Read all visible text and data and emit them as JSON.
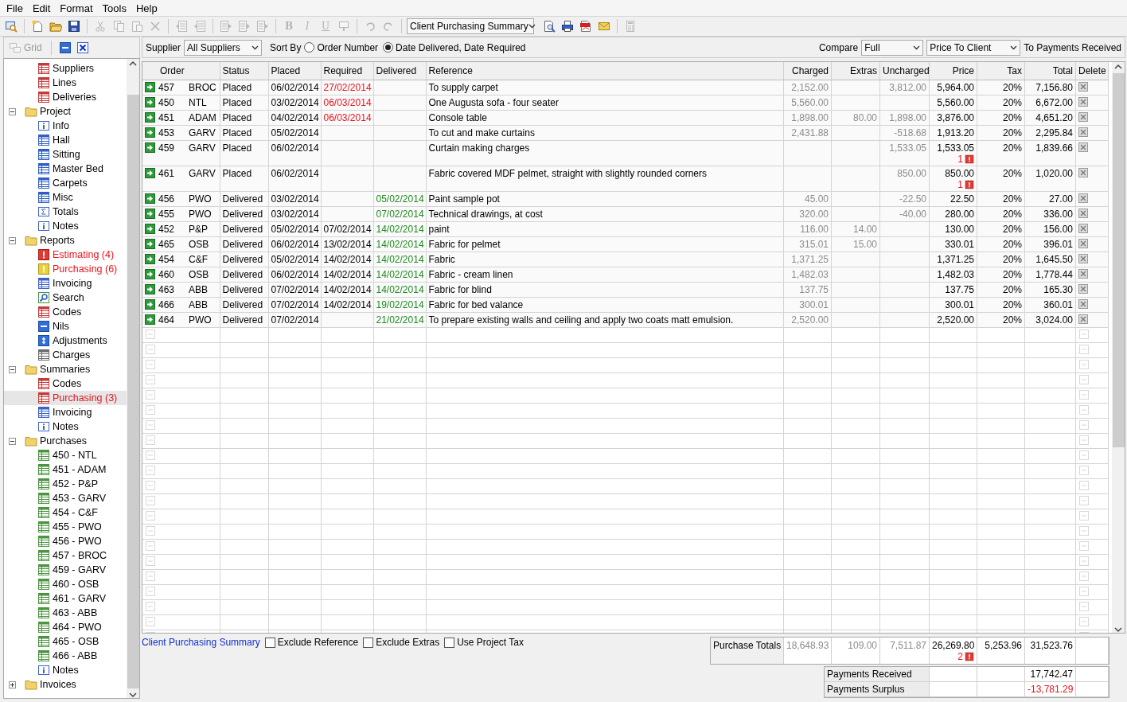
{
  "menu": [
    "File",
    "Edit",
    "Format",
    "Tools",
    "Help"
  ],
  "toolbar": [
    {
      "kind": "find",
      "disabled": false
    },
    {
      "kind": "separator"
    },
    {
      "kind": "new",
      "disabled": false
    },
    {
      "kind": "open",
      "disabled": false
    },
    {
      "kind": "save",
      "disabled": false
    },
    {
      "kind": "separator"
    },
    {
      "kind": "cut",
      "disabled": true
    },
    {
      "kind": "copy",
      "disabled": true
    },
    {
      "kind": "paste",
      "disabled": true
    },
    {
      "kind": "delete",
      "disabled": true
    },
    {
      "kind": "separator"
    },
    {
      "kind": "rows",
      "disabled": true
    },
    {
      "kind": "rows",
      "disabled": true
    },
    {
      "kind": "separator"
    },
    {
      "kind": "indent",
      "disabled": true
    },
    {
      "kind": "indent",
      "disabled": true
    },
    {
      "kind": "indent",
      "disabled": true
    },
    {
      "kind": "separator"
    },
    {
      "kind": "bold",
      "label": "B",
      "disabled": true
    },
    {
      "kind": "italic",
      "label": "I",
      "disabled": true
    },
    {
      "kind": "underline",
      "label": "U",
      "disabled": true
    },
    {
      "kind": "highlight",
      "disabled": true
    },
    {
      "kind": "separator"
    },
    {
      "kind": "undo",
      "disabled": true
    },
    {
      "kind": "redo",
      "disabled": true
    },
    {
      "kind": "separator"
    },
    {
      "kind": "dropdown",
      "value": "Client Purchasing Summary"
    },
    {
      "kind": "preview",
      "disabled": false
    },
    {
      "kind": "print",
      "disabled": false
    },
    {
      "kind": "pdf",
      "disabled": false
    },
    {
      "kind": "email",
      "disabled": false
    },
    {
      "kind": "separator"
    },
    {
      "kind": "calculator",
      "disabled": true
    }
  ],
  "side_header": {
    "grid_label": "Grid",
    "grid_disabled": true
  },
  "tree": [
    {
      "kind": "table",
      "label": "Suppliers",
      "warning": false,
      "selected": false
    },
    {
      "kind": "table",
      "label": "Lines",
      "warning": false,
      "selected": false
    },
    {
      "kind": "table",
      "label": "Deliveries",
      "warning": false,
      "selected": false
    },
    {
      "kind": "folder",
      "label": "Project",
      "expanded": true,
      "selected": false,
      "children": [
        {
          "kind": "info",
          "label": "Info",
          "warning": false,
          "selected": false
        },
        {
          "kind": "room",
          "label": "Hall",
          "warning": false,
          "selected": false
        },
        {
          "kind": "room",
          "label": "Sitting",
          "warning": false,
          "selected": false
        },
        {
          "kind": "room",
          "label": "Master Bed",
          "warning": false,
          "selected": false
        },
        {
          "kind": "room",
          "label": "Carpets",
          "warning": false,
          "selected": false
        },
        {
          "kind": "room",
          "label": "Misc",
          "warning": false,
          "selected": false
        },
        {
          "kind": "total",
          "label": "Totals",
          "warning": false,
          "selected": false
        },
        {
          "kind": "info",
          "label": "Notes",
          "warning": false,
          "selected": false
        }
      ]
    },
    {
      "kind": "folder",
      "label": "Reports",
      "expanded": true,
      "selected": false,
      "children": [
        {
          "kind": "error",
          "label": "Estimating (4)",
          "warning": true,
          "selected": false
        },
        {
          "kind": "alert",
          "label": "Purchasing (6)",
          "warning": true,
          "selected": false
        },
        {
          "kind": "invoice",
          "label": "Invoicing",
          "warning": false,
          "selected": false
        },
        {
          "kind": "search",
          "label": "Search",
          "warning": false,
          "selected": false
        },
        {
          "kind": "table",
          "label": "Codes",
          "warning": false,
          "selected": false
        },
        {
          "kind": "minus",
          "label": "Nils",
          "warning": false,
          "selected": false
        },
        {
          "kind": "adjust",
          "label": "Adjustments",
          "warning": false,
          "selected": false
        },
        {
          "kind": "charges",
          "label": "Charges",
          "warning": false,
          "selected": false
        }
      ]
    },
    {
      "kind": "folder",
      "label": "Summaries",
      "expanded": true,
      "selected": false,
      "children": [
        {
          "kind": "table",
          "label": "Codes",
          "warning": false,
          "selected": false
        },
        {
          "kind": "table",
          "label": "Purchasing (3)",
          "warning": true,
          "selected": true
        },
        {
          "kind": "invoice",
          "label": "Invoicing",
          "warning": false,
          "selected": false
        },
        {
          "kind": "info",
          "label": "Notes",
          "warning": false,
          "selected": false
        }
      ]
    },
    {
      "kind": "folder",
      "label": "Purchases",
      "expanded": true,
      "selected": false,
      "children": [
        {
          "kind": "order",
          "label": "450 - NTL",
          "warning": false,
          "selected": false
        },
        {
          "kind": "order",
          "label": "451 - ADAM",
          "warning": false,
          "selected": false
        },
        {
          "kind": "order",
          "label": "452 - P&P",
          "warning": false,
          "selected": false
        },
        {
          "kind": "order",
          "label": "453 - GARV",
          "warning": false,
          "selected": false
        },
        {
          "kind": "order",
          "label": "454 - C&F",
          "warning": false,
          "selected": false
        },
        {
          "kind": "order",
          "label": "455 - PWO",
          "warning": false,
          "selected": false
        },
        {
          "kind": "order",
          "label": "456 - PWO",
          "warning": false,
          "selected": false
        },
        {
          "kind": "order",
          "label": "457 - BROC",
          "warning": false,
          "selected": false
        },
        {
          "kind": "order",
          "label": "459 - GARV",
          "warning": false,
          "selected": false
        },
        {
          "kind": "order",
          "label": "460 - OSB",
          "warning": false,
          "selected": false
        },
        {
          "kind": "order",
          "label": "461 - GARV",
          "warning": false,
          "selected": false
        },
        {
          "kind": "order",
          "label": "463 - ABB",
          "warning": false,
          "selected": false
        },
        {
          "kind": "order",
          "label": "464 - PWO",
          "warning": false,
          "selected": false
        },
        {
          "kind": "order",
          "label": "465 - OSB",
          "warning": false,
          "selected": false
        },
        {
          "kind": "order",
          "label": "466 - ABB",
          "warning": false,
          "selected": false
        },
        {
          "kind": "info",
          "label": "Notes",
          "warning": false,
          "selected": false
        }
      ]
    },
    {
      "kind": "folder",
      "label": "Invoices",
      "expanded": false,
      "selected": false
    }
  ],
  "filter": {
    "supplier_label": "Supplier",
    "supplier": "All Suppliers",
    "sort_label": "Sort By",
    "sort_options": [
      {
        "label": "Order Number",
        "selected": false
      },
      {
        "label": "Date Delivered, Date Required",
        "selected": true
      }
    ],
    "compare_label": "Compare",
    "compare": "Full",
    "basis": "Price To Client",
    "target": "To Payments Received"
  },
  "table": {
    "columns": [
      "Order",
      "Status",
      "Placed",
      "Required",
      "Delivered",
      "Reference",
      "Charged",
      "Extras",
      "Uncharged",
      "Price",
      "Tax",
      "Total",
      "Delete"
    ],
    "rows": [
      {
        "order": "457",
        "supplier": "BROC",
        "status": "Placed",
        "placed": "06/02/2014",
        "required": "27/02/2014",
        "overdue": true,
        "reference": "To supply carpet",
        "charged": "2,152.00",
        "uncharged": "3,812.00",
        "price": "5,964.00",
        "tax": "20%",
        "total": "7,156.80"
      },
      {
        "order": "450",
        "supplier": "NTL",
        "status": "Placed",
        "placed": "03/02/2014",
        "required": "06/03/2014",
        "overdue": true,
        "reference": "One Augusta  sofa - four seater",
        "charged": "5,560.00",
        "price": "5,560.00",
        "tax": "20%",
        "total": "6,672.00"
      },
      {
        "order": "451",
        "supplier": "ADAM",
        "status": "Placed",
        "placed": "04/02/2014",
        "required": "06/03/2014",
        "overdue": true,
        "reference": "Console table",
        "charged": "1,898.00",
        "extras": "80.00",
        "uncharged": "1,898.00",
        "price": "3,876.00",
        "tax": "20%",
        "total": "4,651.20"
      },
      {
        "order": "453",
        "supplier": "GARV",
        "status": "Placed",
        "placed": "05/02/2014",
        "reference": "To cut and make curtains",
        "charged": "2,431.88",
        "uncharged": "-518.68",
        "price": "1,913.20",
        "tax": "20%",
        "total": "2,295.84"
      },
      {
        "order": "459",
        "supplier": "GARV",
        "status": "Placed",
        "placed": "06/02/2014",
        "reference": "Curtain making charges",
        "uncharged": "1,533.05",
        "price": "1,533.05",
        "price_flag": "1",
        "tax": "20%",
        "total": "1,839.66"
      },
      {
        "order": "461",
        "supplier": "GARV",
        "status": "Placed",
        "placed": "06/02/2014",
        "reference": "Fabric covered MDF pelmet, straight with slightly rounded corners",
        "uncharged": "850.00",
        "price": "850.00",
        "price_flag": "1",
        "tax": "20%",
        "total": "1,020.00"
      },
      {
        "order": "456",
        "supplier": "PWO",
        "status": "Delivered",
        "placed": "03/02/2014",
        "delivered": "05/02/2014",
        "reference": "Paint sample pot",
        "charged": "45.00",
        "uncharged": "-22.50",
        "price": "22.50",
        "tax": "20%",
        "total": "27.00"
      },
      {
        "order": "455",
        "supplier": "PWO",
        "status": "Delivered",
        "placed": "03/02/2014",
        "delivered": "07/02/2014",
        "reference": "Technical drawings, at cost",
        "charged": "320.00",
        "uncharged": "-40.00",
        "price": "280.00",
        "tax": "20%",
        "total": "336.00"
      },
      {
        "order": "452",
        "supplier": "P&P",
        "status": "Delivered",
        "placed": "05/02/2014",
        "required": "07/02/2014",
        "overdue": false,
        "delivered": "14/02/2014",
        "reference": "paint",
        "charged": "116.00",
        "extras": "14.00",
        "price": "130.00",
        "tax": "20%",
        "total": "156.00"
      },
      {
        "order": "465",
        "supplier": "OSB",
        "status": "Delivered",
        "placed": "06/02/2014",
        "required": "13/02/2014",
        "overdue": false,
        "delivered": "14/02/2014",
        "reference": "Fabric for pelmet",
        "charged": "315.01",
        "extras": "15.00",
        "price": "330.01",
        "tax": "20%",
        "total": "396.01"
      },
      {
        "order": "454",
        "supplier": "C&F",
        "status": "Delivered",
        "placed": "05/02/2014",
        "required": "14/02/2014",
        "overdue": false,
        "delivered": "14/02/2014",
        "reference": "Fabric",
        "charged": "1,371.25",
        "price": "1,371.25",
        "tax": "20%",
        "total": "1,645.50"
      },
      {
        "order": "460",
        "supplier": "OSB",
        "status": "Delivered",
        "placed": "06/02/2014",
        "required": "14/02/2014",
        "overdue": false,
        "delivered": "14/02/2014",
        "reference": "Fabric - cream linen",
        "charged": "1,482.03",
        "price": "1,482.03",
        "tax": "20%",
        "total": "1,778.44"
      },
      {
        "order": "463",
        "supplier": "ABB",
        "status": "Delivered",
        "placed": "07/02/2014",
        "required": "14/02/2014",
        "overdue": false,
        "delivered": "14/02/2014",
        "reference": "Fabric for blind",
        "charged": "137.75",
        "price": "137.75",
        "tax": "20%",
        "total": "165.30"
      },
      {
        "order": "466",
        "supplier": "ABB",
        "status": "Delivered",
        "placed": "07/02/2014",
        "required": "14/02/2014",
        "overdue": false,
        "delivered": "19/02/2014",
        "reference": "Fabric for bed valance",
        "charged": "300.01",
        "price": "300.01",
        "tax": "20%",
        "total": "360.01"
      },
      {
        "order": "464",
        "supplier": "PWO",
        "status": "Delivered",
        "placed": "07/02/2014",
        "delivered": "21/02/2014",
        "reference": "To prepare existing walls and ceiling and apply two coats matt emulsion.",
        "charged": "2,520.00",
        "price": "2,520.00",
        "tax": "20%",
        "total": "3,024.00"
      }
    ]
  },
  "footer": {
    "link": "Client Purchasing Summary",
    "options": [
      {
        "label": "Exclude Reference",
        "checked": false
      },
      {
        "label": "Exclude Extras",
        "checked": false
      },
      {
        "label": "Use Project Tax",
        "checked": false
      }
    ],
    "totals": {
      "label": "Purchase Totals",
      "charged": "18,648.93",
      "extras": "109.00",
      "uncharged": "7,511.87",
      "price": "26,269.80",
      "price_flag": "2",
      "tax": "5,253.96",
      "total": "31,523.76"
    },
    "payments": [
      {
        "label": "Payments Received",
        "total": "17,742.47",
        "negative": false
      },
      {
        "label": "Payments Surplus",
        "total": "-13,781.29",
        "negative": true
      }
    ]
  }
}
